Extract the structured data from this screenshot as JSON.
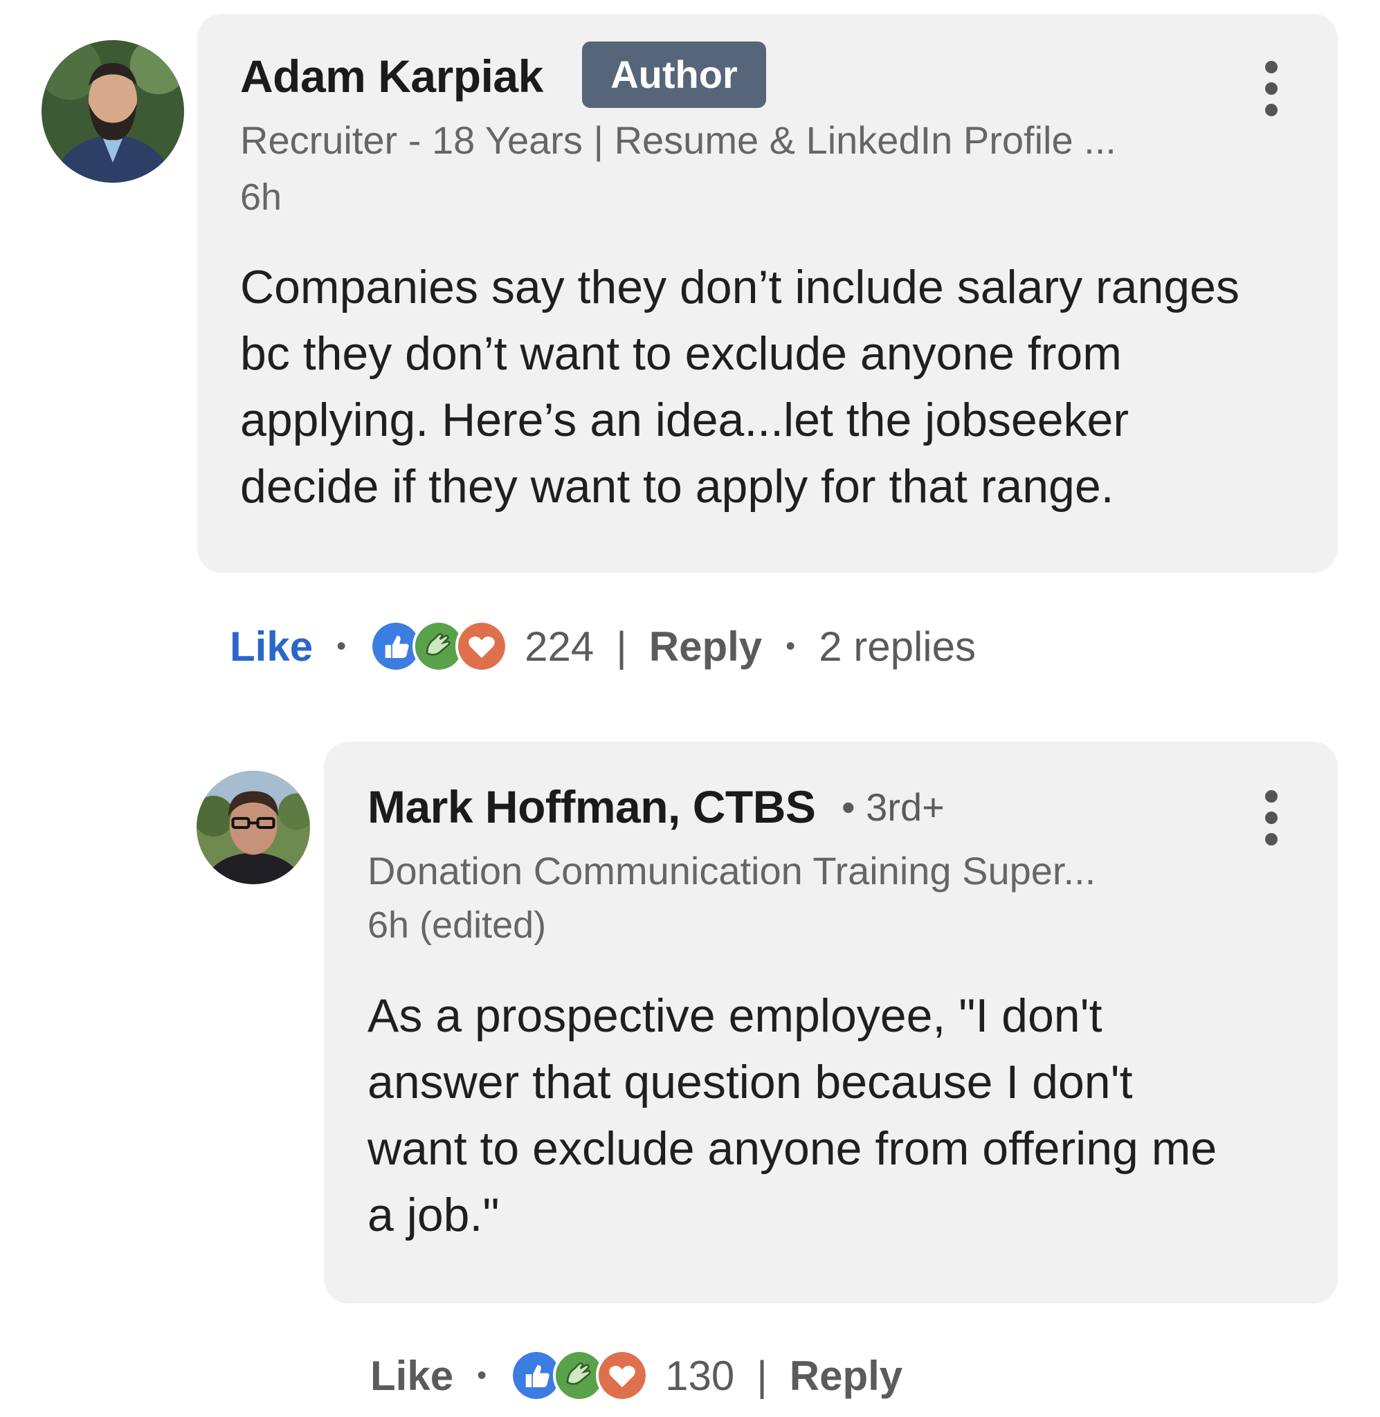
{
  "comments": [
    {
      "name": "Adam Karpiak",
      "badge": "Author",
      "headline": "Recruiter - 18 Years | Resume & LinkedIn Profile ...",
      "time": "6h",
      "body_lines": [
        "Companies say they don’t include salary ranges",
        "bc they don’t want to exclude anyone from",
        "applying. Here’s an idea...let the jobseeker",
        "decide if they want to apply for that range."
      ],
      "actions": {
        "like": "Like",
        "reaction_count": "224",
        "reply": "Reply",
        "replies": "2 replies"
      }
    },
    {
      "name": "Mark Hoffman, CTBS",
      "degree": "• 3rd+",
      "headline": "Donation Communication Training Super...",
      "time": "6h (edited)",
      "body_lines": [
        "As a prospective employee, \"I don't",
        "answer that question because I don't",
        "want to exclude anyone from offering me",
        "a job.\""
      ],
      "actions": {
        "like": "Like",
        "reaction_count": "130",
        "reply": "Reply"
      }
    }
  ],
  "colors": {
    "like_active": "#2a67c9",
    "bubble": "#f1f1f1",
    "badge": "#56657a",
    "reaction_like": "#3b7de0",
    "reaction_celebrate": "#5aa24a",
    "reaction_love": "#df704d"
  },
  "icons": {
    "menu": "more-vertical-icon",
    "reactions": [
      "like-reaction-icon",
      "celebrate-reaction-icon",
      "love-reaction-icon"
    ]
  }
}
